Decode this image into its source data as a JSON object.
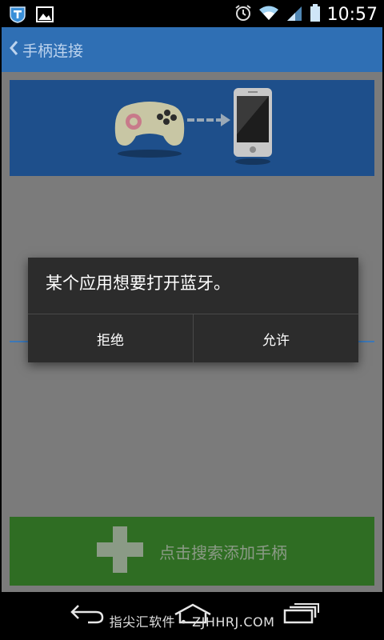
{
  "status_bar": {
    "time": "10:57"
  },
  "app_bar": {
    "title": "手柄连接"
  },
  "dialog": {
    "message": "某个应用想要打开蓝牙。",
    "deny_label": "拒绝",
    "allow_label": "允许"
  },
  "add_button": {
    "label": "点击搜索添加手柄"
  },
  "watermark": {
    "text": "指尖汇软件 • ZJHHRJ.COM"
  },
  "colors": {
    "app_bar": "#2f6fb4",
    "banner": "#1e4f8b",
    "add_button": "#2f6d23",
    "dialog": "#2c2c2c"
  },
  "icons": [
    "t-app-icon",
    "image-icon",
    "alarm-icon",
    "wifi-icon",
    "signal-icon",
    "battery-icon",
    "back-chevron-icon",
    "gamepad-icon",
    "arrow-right-icon",
    "phone-icon",
    "plus-icon",
    "nav-back-icon",
    "nav-home-icon",
    "nav-recent-icon"
  ]
}
